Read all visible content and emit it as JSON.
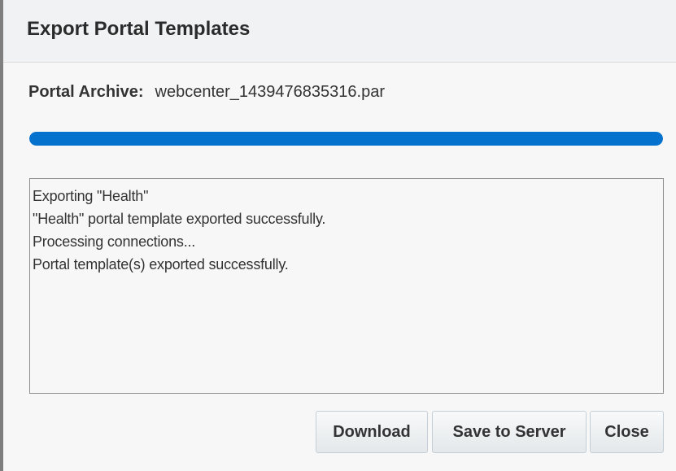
{
  "dialog": {
    "title": "Export Portal Templates",
    "archive_label": "Portal Archive:",
    "archive_value": "webcenter_1439476835316.par",
    "progress_fraction": 1.0,
    "accent_color": "#0572ce"
  },
  "log": {
    "lines": [
      "Exporting \"Health\"",
      "\"Health\" portal template exported successfully.",
      "Processing connections...",
      "Portal template(s) exported successfully."
    ]
  },
  "buttons": {
    "download": "Download",
    "save_to_server": "Save to Server",
    "close": "Close"
  }
}
